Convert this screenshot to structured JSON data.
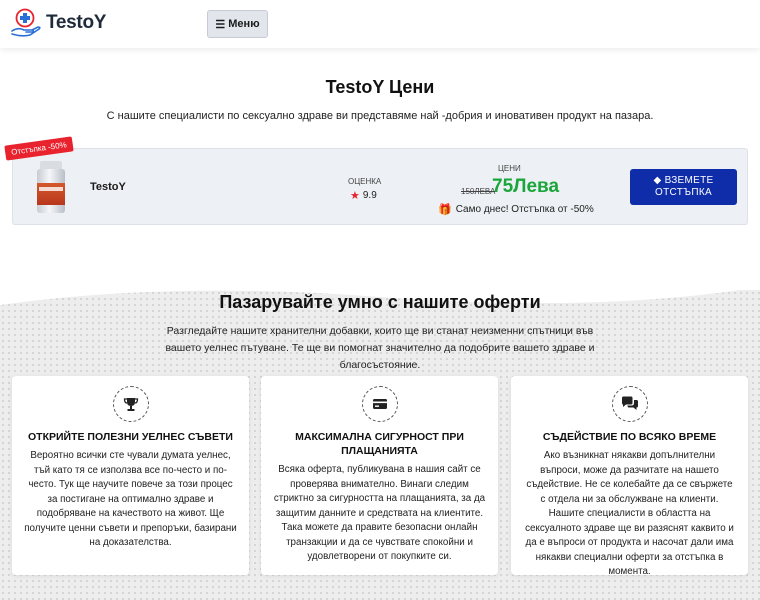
{
  "header": {
    "logo_text": "TestoY",
    "menu_label": "Меню"
  },
  "main": {
    "title": "TestoY Цени",
    "subtitle": "С нашите специалисти по сексуално здраве ви представяме най -добрия и иновативен продукт на пазара."
  },
  "product": {
    "ribbon": "Отстъпка -50%",
    "name": "TestoY",
    "rating_label": "ОЦЕНКА",
    "rating": "9.9",
    "price_label": "ЦЕНИ",
    "old_price": "150ЛЕВА",
    "new_price": "75Лева",
    "deal": "Само днес! Отстъпка от -50%",
    "cta_line1": "ВЗЕМЕТЕ",
    "cta_line2": "ОТСТЪПКА"
  },
  "offers": {
    "title": "Пазарувайте умно с нашите оферти",
    "text": "Разгледайте нашите хранителни добавки, които ще ви станат неизменни спътници във вашето уелнес пътуване. Те ще ви помогнат значително да подобрите вашето здраве и благосъстояние."
  },
  "features": [
    {
      "icon": "trophy-icon",
      "title": "ОТКРИЙТЕ ПОЛЕЗНИ УЕЛНЕС СЪВЕТИ",
      "text": "Вероятно всички сте чували думата уелнес, тъй като тя се използва все по-често и по-често. Тук ще научите повече за този процес за постигане на оптимално здраве и подобряване на качеството на живот. Ще получите ценни съвети и препоръки, базирани на доказателства."
    },
    {
      "icon": "credit-card-icon",
      "title": "МАКСИМАЛНА СИГУРНОСТ ПРИ ПЛАЩАНИЯТА",
      "text": "Всяка оферта, публикувана в нашия сайт се проверява внимателно. Винаги следим стриктно за сигурността на плащанията, за да защитим данните и средствата на клиентите. Така можете да правите безопасни онлайн транзакции и да се чувствате спокойни и удовлетворени от покупките си."
    },
    {
      "icon": "chat-icon",
      "title": "СЪДЕЙСТВИЕ ПО ВСЯКО ВРЕМЕ",
      "text": "Ако възникнат някакви допълнителни въпроси, може да разчитате на нашето съдействие. Не се колебайте да се свържете с отдела ни за обслужване на клиенти. Нашите специалисти в областта на сексуалното здраве ще ви разяснят каквито и да е въпроси от продукта и насочат дали има някакви специални оферти за отстъпка в момента."
    }
  ],
  "colors": {
    "accent_green": "#1aa63a",
    "cta_blue": "#0f2da8",
    "ribbon_red": "#e8232e"
  }
}
